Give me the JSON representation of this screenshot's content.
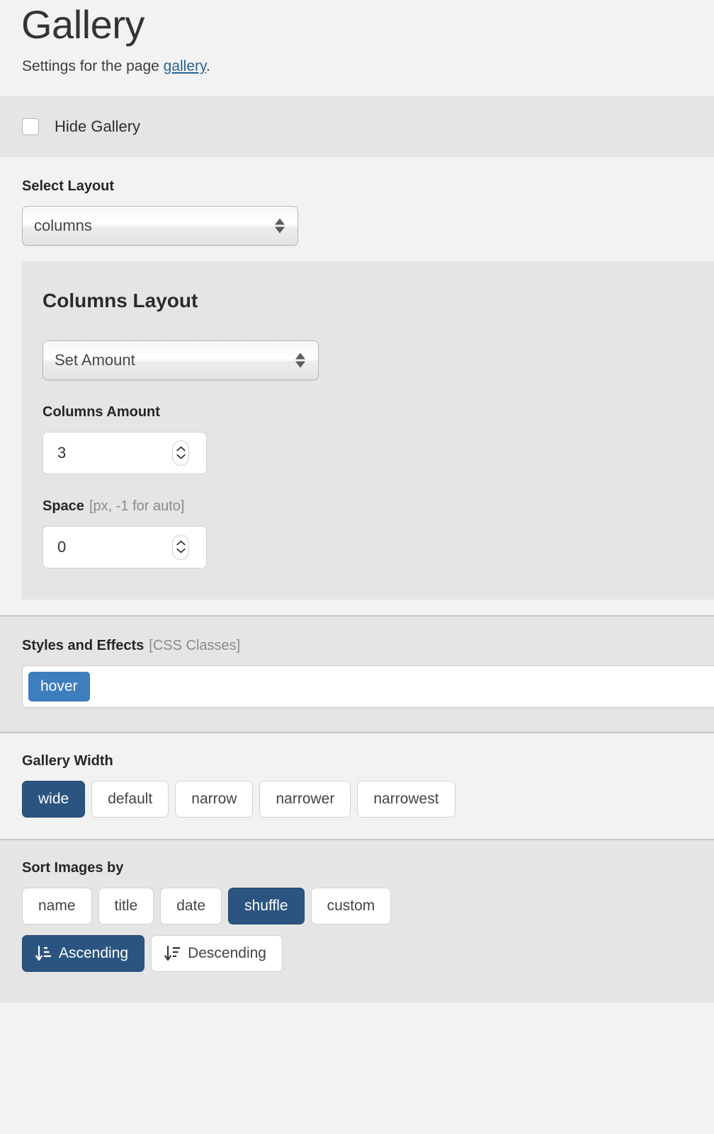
{
  "header": {
    "title": "Gallery",
    "subtitle_prefix": "Settings for the page ",
    "subtitle_link": "gallery",
    "subtitle_suffix": "."
  },
  "hide_gallery": {
    "label": "Hide Gallery",
    "checked": false
  },
  "select_layout": {
    "label": "Select Layout",
    "value": "columns"
  },
  "columns_layout": {
    "title": "Columns Layout",
    "mode": {
      "value": "Set Amount"
    },
    "amount": {
      "label": "Columns Amount",
      "value": "3"
    },
    "space": {
      "label": "Space",
      "hint": "[px, -1 for auto]",
      "value": "0"
    }
  },
  "styles_and_effects": {
    "label": "Styles and Effects",
    "hint": "[CSS Classes]",
    "tags": [
      "hover"
    ],
    "tag_color": "#3c7ebe"
  },
  "gallery_width": {
    "label": "Gallery Width",
    "options": [
      "wide",
      "default",
      "narrow",
      "narrower",
      "narrowest"
    ],
    "selected": "wide"
  },
  "sort_images": {
    "label": "Sort Images by",
    "options": [
      "name",
      "title",
      "date",
      "shuffle",
      "custom"
    ],
    "selected": "shuffle",
    "direction_options": [
      {
        "label": "Ascending",
        "icon": "sort-amount-asc-icon"
      },
      {
        "label": "Descending",
        "icon": "sort-amount-desc-icon"
      }
    ],
    "direction_selected": "Ascending"
  },
  "colors": {
    "accent": "#2b5580",
    "tag": "#3c7ebe",
    "link": "#2a6496",
    "band_light": "#f2f2f2",
    "band_dark": "#e5e5e5"
  }
}
